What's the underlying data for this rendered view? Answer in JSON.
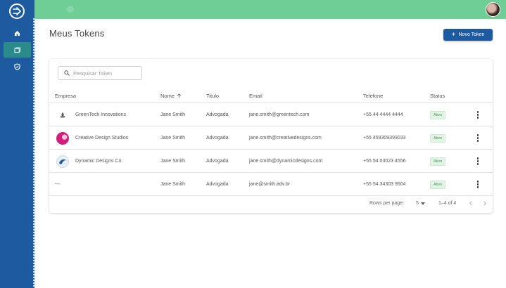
{
  "header": {
    "title": "Meus Tokens",
    "new_button_label": "Novo Token"
  },
  "search": {
    "placeholder": "Pesquisar Token",
    "value": ""
  },
  "table": {
    "columns": [
      "Empresa",
      "Nome",
      "Titulo",
      "Email",
      "Telefone",
      "Status"
    ],
    "sort_column": "Nome",
    "sort_direction": "ascending",
    "rows": [
      {
        "empresa": "GreenTech Innovations",
        "nome": "Jane Smith",
        "titulo": "Advogada",
        "email": "jane.smith@greentech.com",
        "telefone": "+55 44 4444 4444",
        "status": "Ativo"
      },
      {
        "empresa": "Creative Design Studios",
        "nome": "Jane Smith",
        "titulo": "Advogada",
        "email": "jane.smith@creativedesigns.com",
        "telefone": "+55 459309393033",
        "status": "Ativo"
      },
      {
        "empresa": "Dynamic Designs Co.",
        "nome": "Jane Smith",
        "titulo": "Advogada",
        "email": "jane.smith@dynamicdesigns.com",
        "telefone": "+55 54 03023 4556",
        "status": "Ativo"
      },
      {
        "empresa": "---",
        "nome": "Jane Smith",
        "titulo": "Advogada",
        "email": "jane@smith.adv.br",
        "telefone": "+55 54 34303 9504",
        "status": "Ativo"
      }
    ]
  },
  "pagination": {
    "rows_per_page_label": "Rows per page:",
    "rows_per_page_value": "5",
    "range": "1–4 of 4"
  },
  "colors": {
    "sidebar": "#1e5aa0",
    "topbar": "#6fcd96",
    "active_nav": "#2a8a8c",
    "primary_button": "#1e5aa0",
    "status_active_text": "#3d9a55",
    "status_active_bg": "#e3f4e7"
  },
  "icons": {
    "sidebar": [
      "logo-icon",
      "home-icon",
      "tokens-icon",
      "shield-icon"
    ],
    "topbar": [
      "settings-gear-icon",
      "user-avatar"
    ],
    "table": [
      "search-icon",
      "sort-arrow-up-icon",
      "more-vertical-icon",
      "chevron-left-icon",
      "chevron-right-icon",
      "dropdown-arrow-icon"
    ]
  }
}
